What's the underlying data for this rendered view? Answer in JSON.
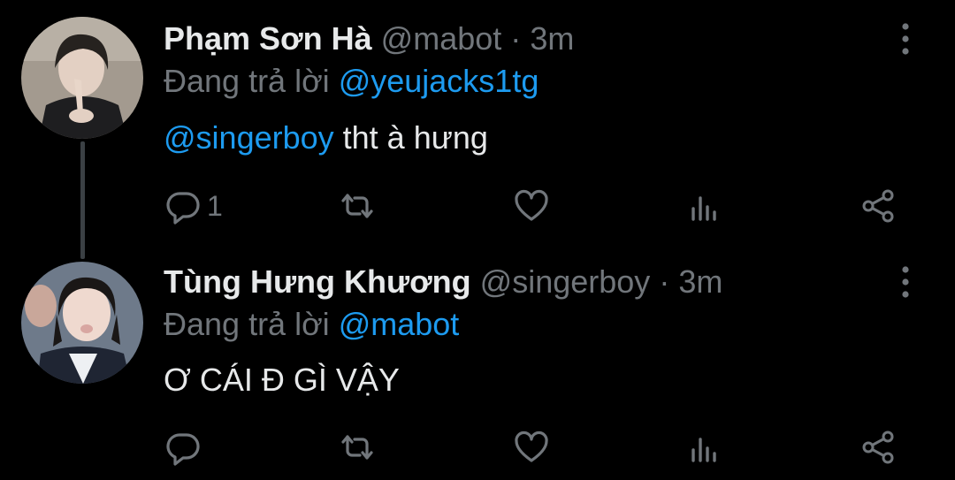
{
  "tweets": [
    {
      "display_name": "Phạm Sơn Hà",
      "handle": "@mabot",
      "separator": "·",
      "time": "3m",
      "replying_prefix": "Đang trả lời",
      "replying_to": "@yeujacks1tg",
      "mention": "@singerboy",
      "text": " tht à hưng",
      "reply_count": "1"
    },
    {
      "display_name": "Tùng Hưng Khương",
      "handle": "@singerboy",
      "separator": "·",
      "time": "3m",
      "replying_prefix": "Đang trả lời",
      "replying_to": "@mabot",
      "text": "Ơ CÁI Đ GÌ VẬY",
      "reply_count": ""
    }
  ],
  "icons": {
    "reply": "speech-bubble",
    "retweet": "retweet-arrows",
    "like": "heart",
    "views": "bar-chart",
    "share": "share-nodes",
    "more": "vertical-dots"
  },
  "colors": {
    "background": "#000000",
    "primary_text": "#e7e9ea",
    "secondary_text": "#71767b",
    "link": "#1d9bf0",
    "thread_line": "#3b4044"
  }
}
